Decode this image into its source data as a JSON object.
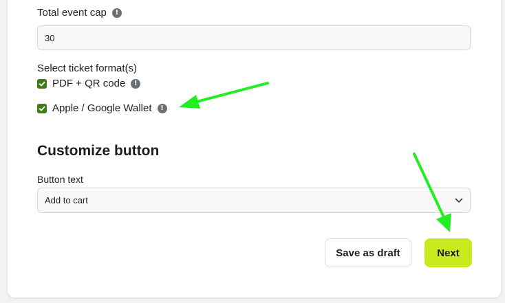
{
  "form": {
    "total_event_cap": {
      "label": "Total event cap",
      "value": "30"
    },
    "ticket_formats": {
      "label": "Select ticket format(s)",
      "options": [
        {
          "label": "PDF + QR code",
          "checked": true
        },
        {
          "label": "Apple / Google Wallet",
          "checked": true
        }
      ]
    },
    "info_glyph": "!"
  },
  "customize": {
    "title": "Customize button",
    "button_text_label": "Button text",
    "button_text_value": "Add to cart"
  },
  "actions": {
    "save_draft_label": "Save as draft",
    "next_label": "Next"
  },
  "colors": {
    "accent": "#c8ea1e",
    "checkbox": "#3f7a1b",
    "annotation_arrow": "#22ee22"
  }
}
